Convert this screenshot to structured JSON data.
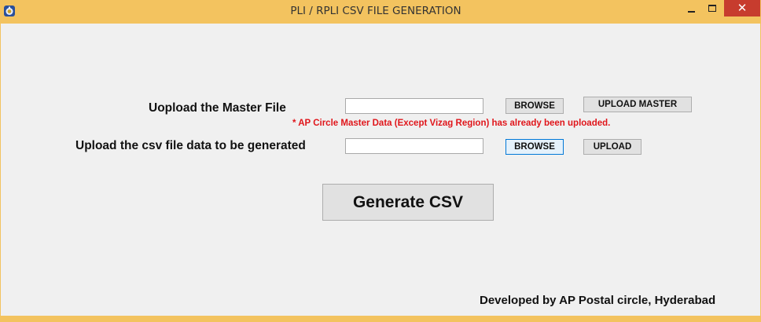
{
  "window": {
    "title": "PLI / RPLI CSV FILE GENERATION",
    "icon": "app-emblem-icon",
    "controls": {
      "minimize": "minimize-icon",
      "maximize": "maximize-icon",
      "close": "✕"
    }
  },
  "master_upload": {
    "label": "Uopload the Master File",
    "file_value": "",
    "browse_label": "BROWSE",
    "upload_label": "UPLOAD MASTER",
    "note": "* AP Circle Master Data (Except Vizag Region) has already been uploaded."
  },
  "csv_upload": {
    "label": "Upload the csv file data to be generated",
    "file_value": "",
    "browse_label": "BROWSE",
    "upload_label": "UPLOAD"
  },
  "generate_label": "Generate CSV",
  "footer": "Developed by AP Postal circle, Hyderabad",
  "colors": {
    "title_bar": "#f3c35f",
    "client_bg": "#f0f0f0",
    "note_red": "#e0161b",
    "close_red": "#c73c2e",
    "focus_blue": "#0078d7"
  }
}
